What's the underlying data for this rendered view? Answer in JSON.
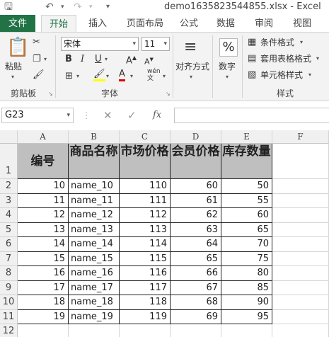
{
  "window": {
    "title": "demo1635823544855.xlsx - Excel"
  },
  "tabs": {
    "file": "文件",
    "items": [
      "开始",
      "插入",
      "页面布局",
      "公式",
      "数据",
      "审阅",
      "视图"
    ]
  },
  "ribbon": {
    "clipboard": {
      "label": "剪贴板",
      "paste": "粘贴"
    },
    "font": {
      "label": "字体",
      "name": "宋体",
      "size": "11"
    },
    "alignment": {
      "label": "对齐方式"
    },
    "number": {
      "label": "数字",
      "symbol": "%"
    },
    "styles": {
      "label": "样式",
      "conditional": "条件格式",
      "table": "套用表格格式",
      "cell": "单元格样式"
    }
  },
  "formula_bar": {
    "name_box": "G23",
    "fx": "fx",
    "value": ""
  },
  "sheet": {
    "columns": [
      "A",
      "B",
      "C",
      "D",
      "E",
      "F"
    ],
    "header_row": [
      "编号",
      "商品名称",
      "市场价格",
      "会员价格",
      "库存数量"
    ],
    "rows": [
      [
        "10",
        "name_10",
        "110",
        "60",
        "50"
      ],
      [
        "11",
        "name_11",
        "111",
        "61",
        "55"
      ],
      [
        "12",
        "name_12",
        "112",
        "62",
        "60"
      ],
      [
        "13",
        "name_13",
        "113",
        "63",
        "65"
      ],
      [
        "14",
        "name_14",
        "114",
        "64",
        "70"
      ],
      [
        "15",
        "name_15",
        "115",
        "65",
        "75"
      ],
      [
        "16",
        "name_16",
        "116",
        "66",
        "80"
      ],
      [
        "17",
        "name_17",
        "117",
        "67",
        "85"
      ],
      [
        "18",
        "name_18",
        "118",
        "68",
        "90"
      ],
      [
        "19",
        "name_19",
        "119",
        "69",
        "95"
      ]
    ],
    "row_numbers": [
      "1",
      "2",
      "3",
      "4",
      "5",
      "6",
      "7",
      "8",
      "9",
      "10",
      "11",
      "12"
    ]
  },
  "colors": {
    "excel_green": "#217346",
    "header_fill": "#bfbfbf"
  }
}
